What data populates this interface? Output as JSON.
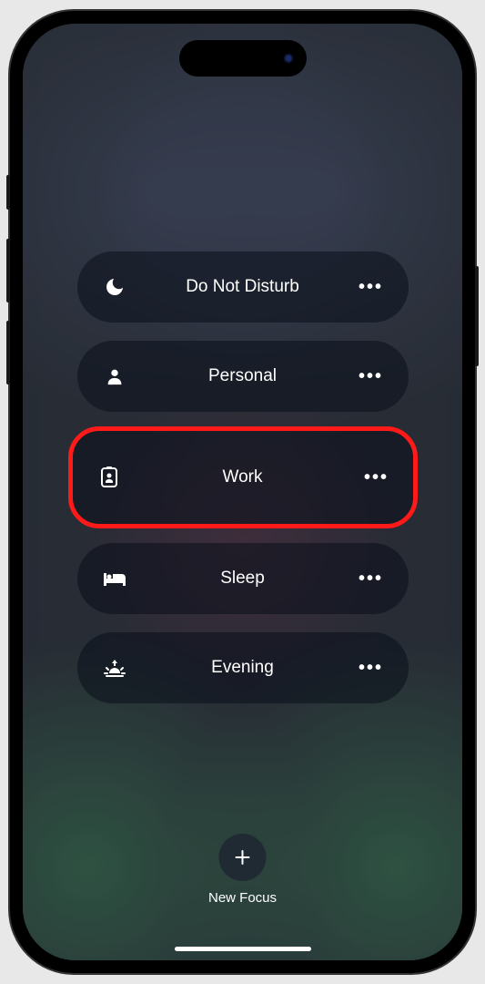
{
  "focus_modes": [
    {
      "id": "do-not-disturb",
      "label": "Do Not Disturb",
      "icon": "moon-icon"
    },
    {
      "id": "personal",
      "label": "Personal",
      "icon": "person-icon"
    },
    {
      "id": "work",
      "label": "Work",
      "icon": "badge-icon",
      "highlighted": true
    },
    {
      "id": "sleep",
      "label": "Sleep",
      "icon": "bed-icon"
    },
    {
      "id": "evening",
      "label": "Evening",
      "icon": "sunset-icon"
    }
  ],
  "new_focus": {
    "label": "New Focus"
  }
}
